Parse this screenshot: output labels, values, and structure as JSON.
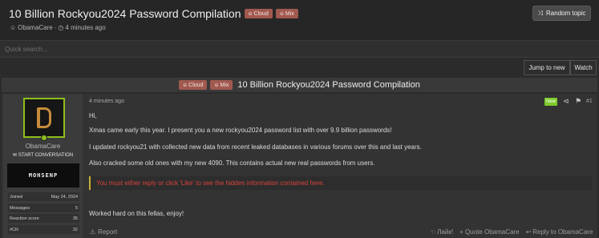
{
  "thread": {
    "title": "10 Billion Rockyou2024 Password Compilation",
    "tags": [
      "Cloud",
      "Mix"
    ],
    "author": "ObamaCare",
    "age": "4 minutes ago",
    "random_topic_label": "Random topic"
  },
  "search": {
    "placeholder": "Quick search..."
  },
  "actions": {
    "jump_to_new": "Jump to new",
    "watch": "Watch"
  },
  "post": {
    "timestamp": "4 minutes ago",
    "new_badge": "New",
    "number": "#1",
    "lines": [
      "Hi,",
      "Xmas came early this year. I present you a new rockyou2024 password list with over 9.9 billion passwords!",
      "I updated rockyou21 with collected new data from recent leaked databases in various forums over this and last years.",
      "Also cracked some old ones with my new 4090. This contains actual new real passwords from users.",
      "Worked hard on this fellas, enjoy!"
    ],
    "hidden_notice": "You must either reply or click 'Like' to see the hidden information contained here.",
    "report_label": "Report",
    "like_label": "Лайк!",
    "quote_label": "+ Quote ObamaCare",
    "reply_label": "Reply to ObamaCare"
  },
  "user": {
    "name": "ObamaCare",
    "start_conversation": "START CONVERSATION",
    "banner_text": "MOHSENP",
    "stats": [
      {
        "label": "Joined",
        "value": "May 24, 2024"
      },
      {
        "label": "Messages",
        "value": "5"
      },
      {
        "label": "Reaction score",
        "value": "35"
      },
      {
        "label": "#CR",
        "value": "32"
      }
    ]
  },
  "colors": {
    "tag": "#a1594f",
    "online": "#8fbf1a",
    "new_badge": "#7ccb2a",
    "hidden_text": "#d9433a",
    "hidden_border": "#c8b03a"
  },
  "icons": [
    "user-icon",
    "clock-icon",
    "shuffle-icon",
    "cloud-tag-icon",
    "share-icon",
    "bookmark-icon",
    "envelope-icon",
    "warning-icon",
    "like-icon",
    "reply-icon"
  ]
}
